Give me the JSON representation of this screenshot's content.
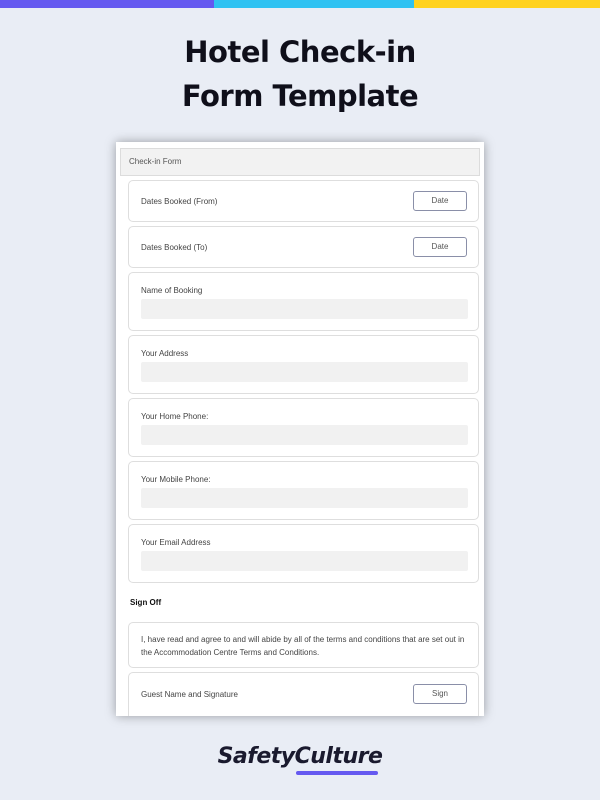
{
  "colors": {
    "bar_purple": "#6559f0",
    "bar_blue": "#2fc2f2",
    "bar_yellow": "#ffd21f",
    "background": "#e9edf5",
    "logo_accent": "#6559f0"
  },
  "title": {
    "line1": "Hotel Check-in",
    "line2": "Form Template"
  },
  "form": {
    "header": "Check-in Form",
    "dates_from": {
      "label": "Dates Booked (From)",
      "button": "Date"
    },
    "dates_to": {
      "label": "Dates Booked (To)",
      "button": "Date"
    },
    "name_of_booking": {
      "label": "Name of Booking",
      "value": ""
    },
    "address": {
      "label": "Your Address",
      "value": ""
    },
    "home_phone": {
      "label": "Your Home Phone:",
      "value": ""
    },
    "mobile_phone": {
      "label": "Your Mobile Phone:",
      "value": ""
    },
    "email": {
      "label": "Your Email Address",
      "value": ""
    },
    "sign_off": {
      "heading": "Sign Off",
      "terms": "I, have read and agree to and will abide by all of the terms and conditions that are set out in the Accommodation Centre Terms and Conditions.",
      "guest_label": "Guest Name and Signature",
      "sign_button": "Sign"
    }
  },
  "brand": {
    "logo_text": "SafetyCulture"
  }
}
